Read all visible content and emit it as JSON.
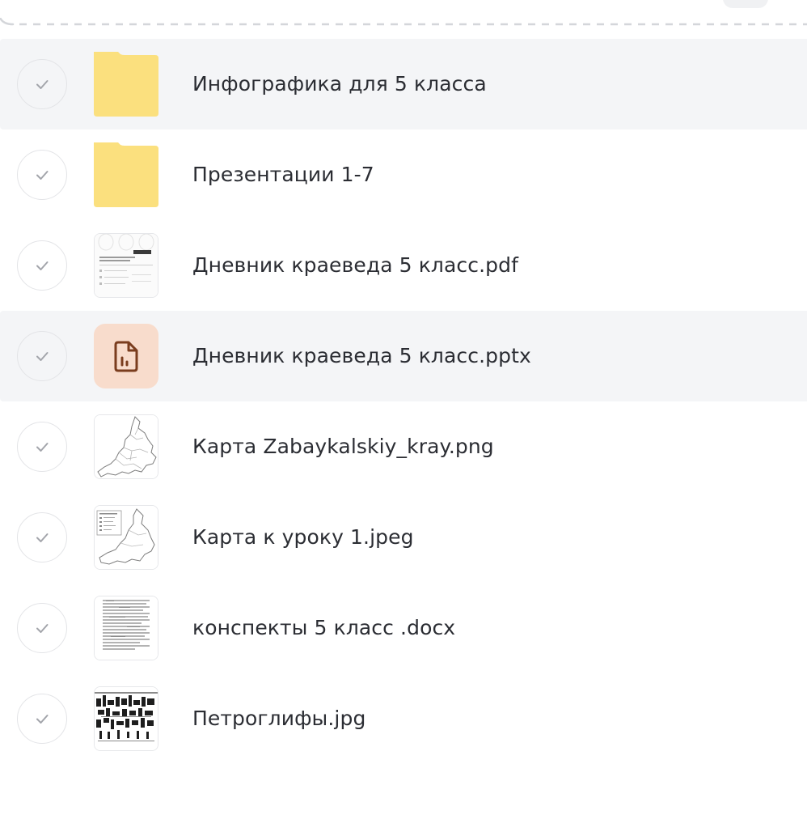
{
  "colors": {
    "folder": "#fbe07e",
    "folder_tab": "#fbe07e",
    "pptx_bg": "#f8dccc",
    "pptx_icon": "#7a3d1e",
    "hover_row": "#f4f5f7",
    "check": "#a3a5ab"
  },
  "files": [
    {
      "name": "Инфографика для 5 класса",
      "kind": "folder",
      "icon": "folder-icon"
    },
    {
      "name": "Презентации 1-7",
      "kind": "folder",
      "icon": "folder-icon"
    },
    {
      "name": "Дневник краеведа 5 класс.pdf",
      "kind": "pdf",
      "icon": "pdf-thumbnail"
    },
    {
      "name": "Дневник краеведа 5 класс.pptx",
      "kind": "pptx",
      "icon": "presentation-file-icon"
    },
    {
      "name": "Карта Zabaykalskiy_kray.png",
      "kind": "png",
      "icon": "map-thumbnail"
    },
    {
      "name": "Карта к уроку 1.jpeg",
      "kind": "jpeg",
      "icon": "map-thumbnail"
    },
    {
      "name": "конспекты 5 класс .docx",
      "kind": "docx",
      "icon": "document-thumbnail"
    },
    {
      "name": "Петроглифы.jpg",
      "kind": "jpg",
      "icon": "petroglyphs-thumbnail"
    }
  ]
}
